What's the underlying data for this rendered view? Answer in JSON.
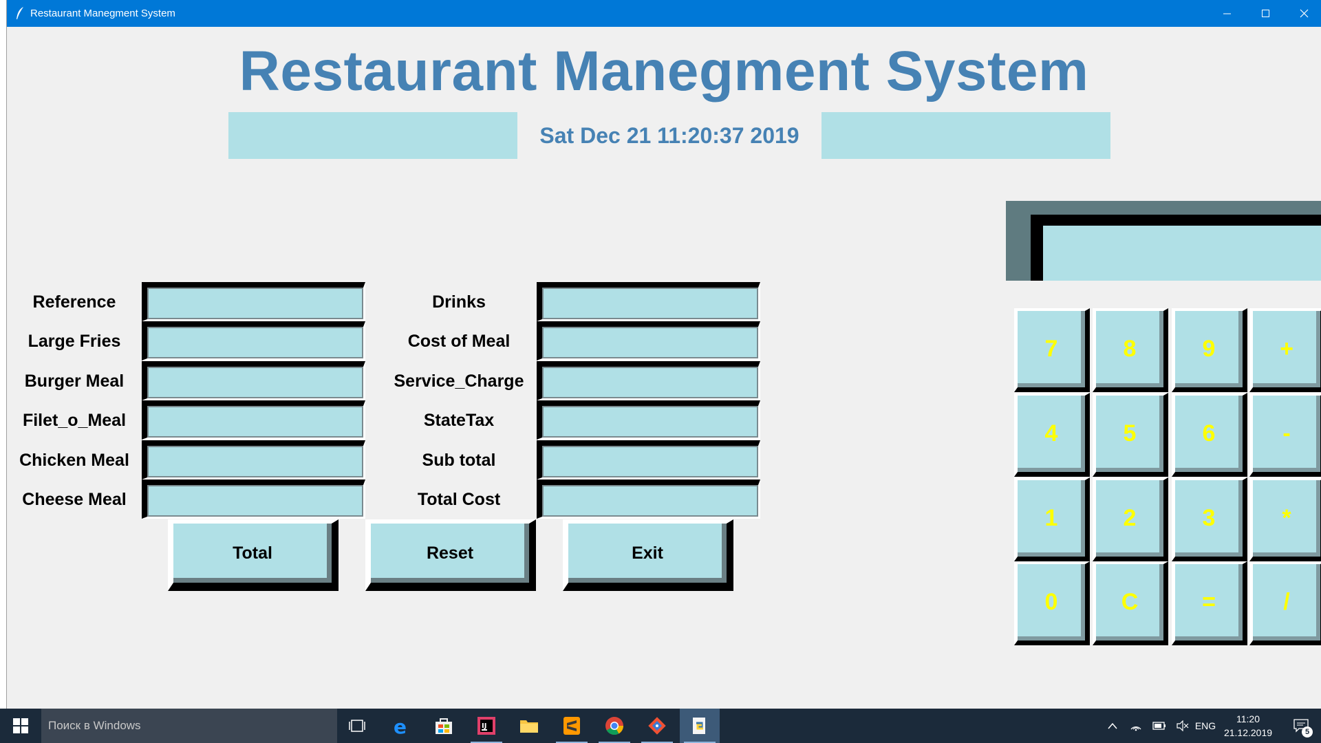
{
  "window": {
    "title": "Restaurant Manegment System",
    "controls": {
      "minimize": "minimize",
      "maximize": "maximize",
      "close": "close"
    }
  },
  "header": {
    "title": "Restaurant Manegment System",
    "datetime": "Sat Dec 21 11:20:37 2019"
  },
  "form": {
    "left_fields": [
      {
        "label": "Reference",
        "value": ""
      },
      {
        "label": "Large Fries",
        "value": ""
      },
      {
        "label": "Burger Meal",
        "value": ""
      },
      {
        "label": "Filet_o_Meal",
        "value": ""
      },
      {
        "label": "Chicken Meal",
        "value": ""
      },
      {
        "label": "Cheese Meal",
        "value": ""
      }
    ],
    "right_fields": [
      {
        "label": "Drinks",
        "value": ""
      },
      {
        "label": "Cost of Meal",
        "value": ""
      },
      {
        "label": "Service_Charge",
        "value": ""
      },
      {
        "label": "StateTax",
        "value": ""
      },
      {
        "label": "Sub total",
        "value": ""
      },
      {
        "label": "Total Cost",
        "value": ""
      }
    ],
    "buttons": {
      "total": "Total",
      "reset": "Reset",
      "exit": "Exit"
    }
  },
  "calculator": {
    "display": "",
    "keys": [
      [
        "7",
        "8",
        "9",
        "+"
      ],
      [
        "4",
        "5",
        "6",
        "-"
      ],
      [
        "1",
        "2",
        "3",
        "*"
      ],
      [
        "0",
        "C",
        "=",
        "/"
      ]
    ]
  },
  "taskbar": {
    "search_placeholder": "Поиск в Windows",
    "apps": [
      "task-view",
      "edge",
      "store",
      "intellij",
      "file-explorer",
      "sublime-text",
      "chrome",
      "git",
      "python-idle"
    ],
    "language": "ENG",
    "time": "11:20",
    "date": "21.12.2019",
    "notification_count": "5"
  },
  "colors": {
    "accent": "#4682b4",
    "field_bg": "#b0e0e6",
    "key_text": "#ffff00",
    "titlebar": "#0078d7",
    "taskbar": "#1b2a3a"
  }
}
